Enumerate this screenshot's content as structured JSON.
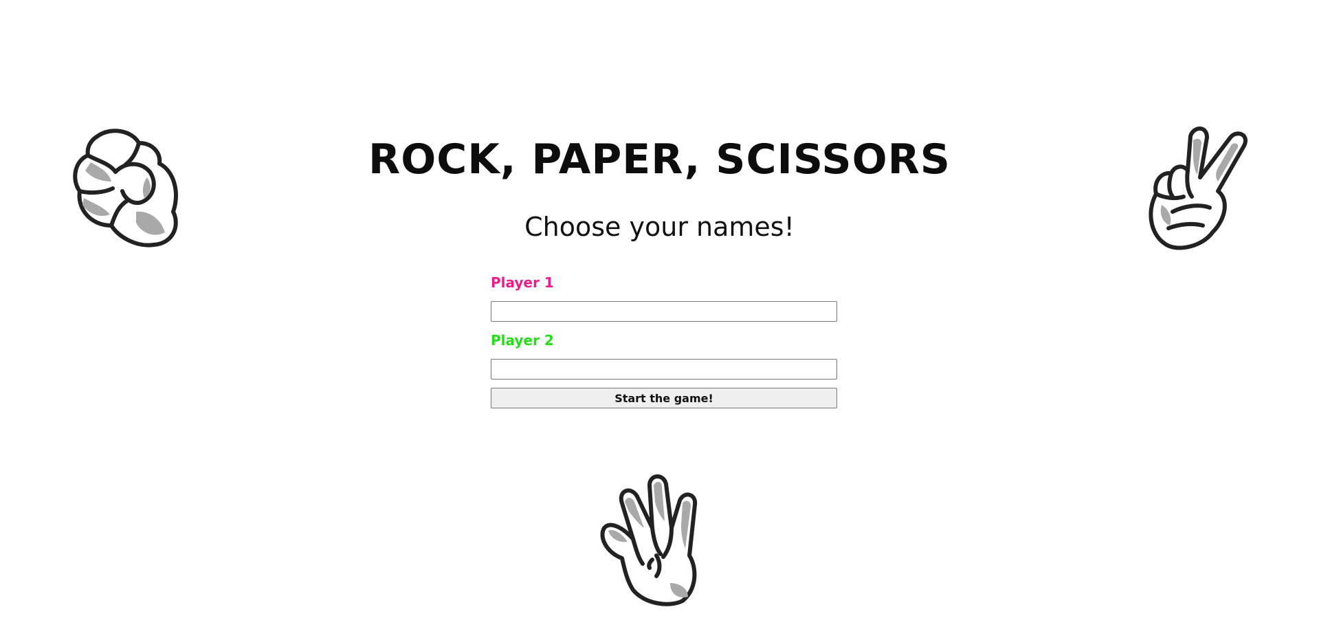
{
  "header": {
    "title": "ROCK, PAPER, SCISSORS",
    "subtitle": "Choose your names!"
  },
  "form": {
    "player1": {
      "label": "Player 1",
      "value": "",
      "label_color": "#ee1c8a"
    },
    "player2": {
      "label": "Player 2",
      "value": "",
      "label_color": "#22e015"
    },
    "start_label": "Start the game!"
  },
  "icons": {
    "rock": "fist-hand-icon",
    "scissors": "peace-sign-hand-icon",
    "paper": "open-palm-hand-icon"
  }
}
